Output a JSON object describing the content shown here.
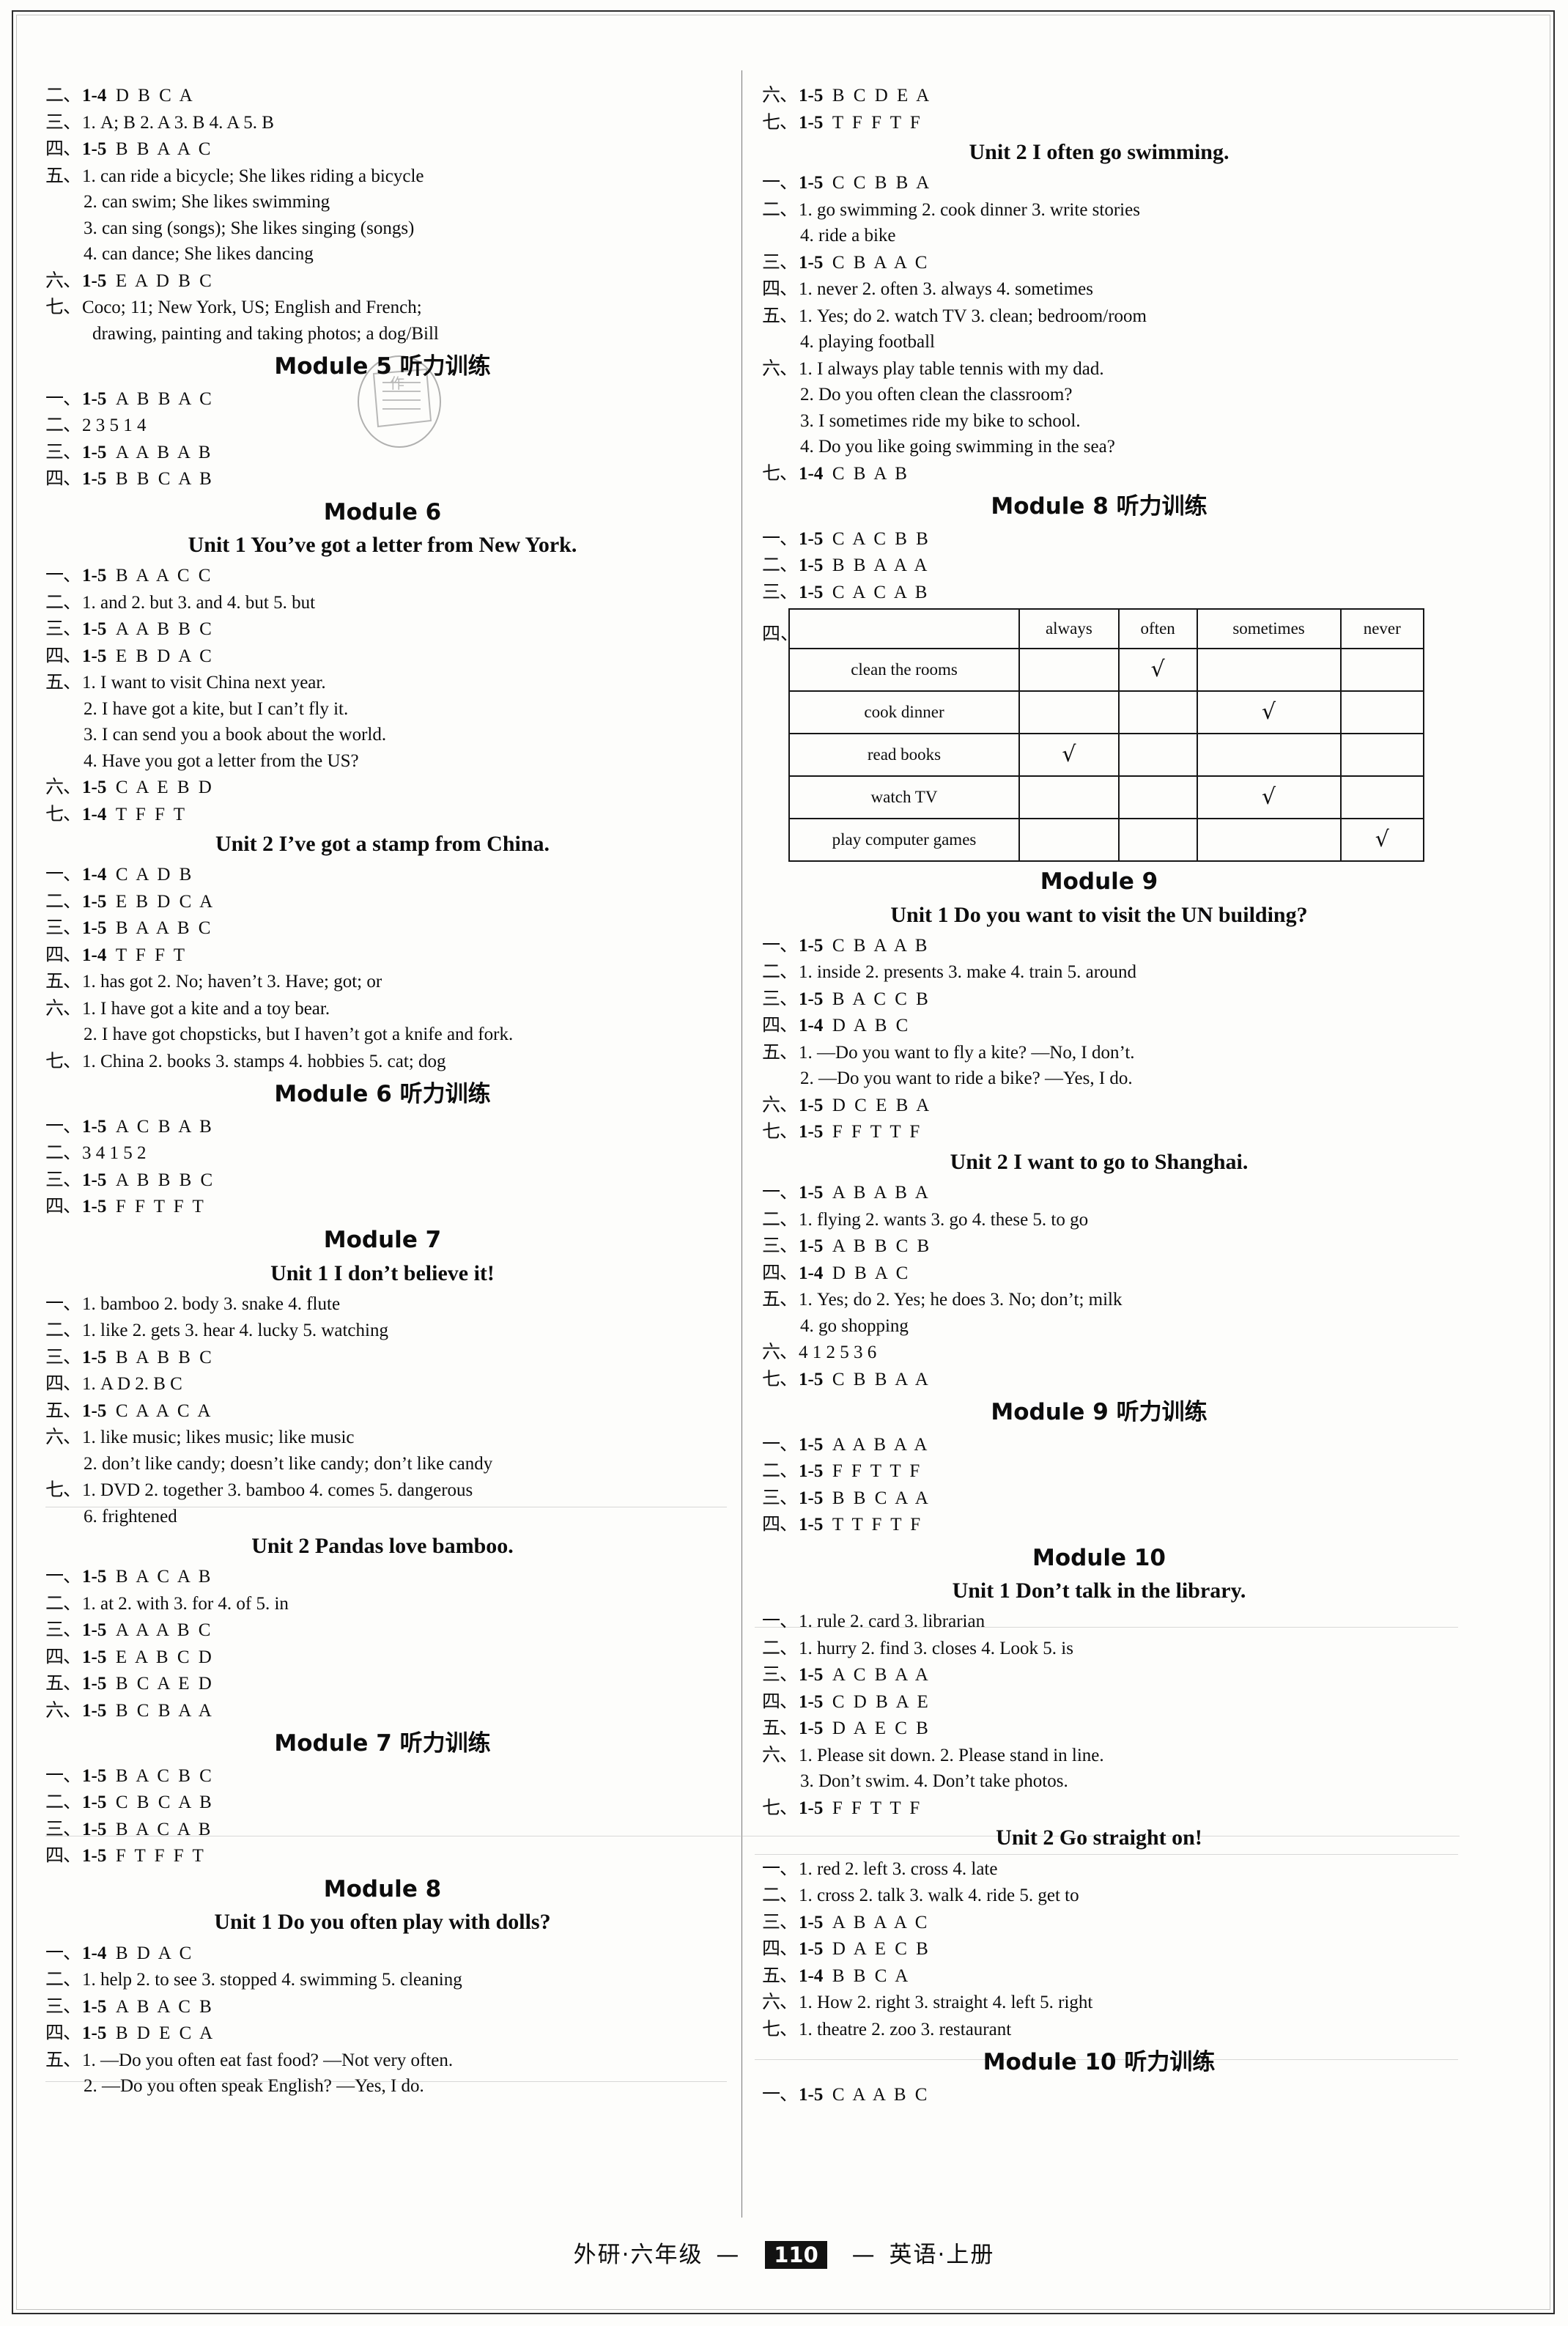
{
  "footer": {
    "left_text": "外研·六年级",
    "dash_left": "—",
    "page_number": "110",
    "dash_right": "—",
    "right_text": "英语·上册"
  },
  "left_column": [
    {
      "kind": "answer",
      "marker": "二、",
      "range": "1-4",
      "answers": "D B C A"
    },
    {
      "kind": "inline",
      "marker": "三、",
      "text": "1. A; B   2. A   3. B   4. A   5. B"
    },
    {
      "kind": "answer",
      "marker": "四、",
      "range": "1-5",
      "answers": "B B A A C"
    },
    {
      "kind": "inline",
      "marker": "五、",
      "text": "1. can ride a bicycle; She likes riding a bicycle"
    },
    {
      "kind": "sub",
      "text": "2. can swim; She likes swimming"
    },
    {
      "kind": "sub",
      "text": "3. can sing (songs); She likes singing (songs)"
    },
    {
      "kind": "sub",
      "text": "4. can dance; She likes dancing"
    },
    {
      "kind": "answer",
      "marker": "六、",
      "range": "1-5",
      "answers": "E A D B C"
    },
    {
      "kind": "inline",
      "marker": "七、",
      "text": "Coco; 11; New York, US; English and French;"
    },
    {
      "kind": "cont",
      "text": "drawing, painting and taking photos; a dog/Bill"
    },
    {
      "kind": "module",
      "text": "Module 5   听力训练"
    },
    {
      "kind": "answer",
      "marker": "一、",
      "range": "1-5",
      "answers": "A B B A C"
    },
    {
      "kind": "inline",
      "marker": "二、",
      "text": "2 3 5 1 4"
    },
    {
      "kind": "answer",
      "marker": "三、",
      "range": "1-5",
      "answers": "A A B A B"
    },
    {
      "kind": "answer",
      "marker": "四、",
      "range": "1-5",
      "answers": "B B C A B"
    },
    {
      "kind": "module",
      "text": "Module 6"
    },
    {
      "kind": "unit",
      "text": "Unit 1   You’ve got a letter from New York."
    },
    {
      "kind": "answer",
      "marker": "一、",
      "range": "1-5",
      "answers": "B A A C C"
    },
    {
      "kind": "inline",
      "marker": "二、",
      "text": "1. and   2. but   3. and   4. but   5. but"
    },
    {
      "kind": "answer",
      "marker": "三、",
      "range": "1-5",
      "answers": "A A B B C"
    },
    {
      "kind": "answer",
      "marker": "四、",
      "range": "1-5",
      "answers": "E B D A C"
    },
    {
      "kind": "inline",
      "marker": "五、",
      "text": "1. I want to visit China next year."
    },
    {
      "kind": "sub",
      "text": "2. I have got a kite, but I can’t fly it."
    },
    {
      "kind": "sub",
      "text": "3. I can send you a book about the world."
    },
    {
      "kind": "sub",
      "text": "4. Have you got a letter from the US?"
    },
    {
      "kind": "answer",
      "marker": "六、",
      "range": "1-5",
      "answers": "C A E B D"
    },
    {
      "kind": "answer",
      "marker": "七、",
      "range": "1-4",
      "answers": "T F F T"
    },
    {
      "kind": "unit",
      "text": "Unit 2   I’ve got a stamp from China."
    },
    {
      "kind": "answer",
      "marker": "一、",
      "range": "1-4",
      "answers": "C A D B"
    },
    {
      "kind": "answer",
      "marker": "二、",
      "range": "1-5",
      "answers": "E B D C A"
    },
    {
      "kind": "answer",
      "marker": "三、",
      "range": "1-5",
      "answers": "B A A B C"
    },
    {
      "kind": "answer",
      "marker": "四、",
      "range": "1-4",
      "answers": "T F F T"
    },
    {
      "kind": "inline",
      "marker": "五、",
      "text": "1. has got   2. No; haven’t   3. Have; got; or"
    },
    {
      "kind": "inline",
      "marker": "六、",
      "text": "1. I have got a kite and a toy bear."
    },
    {
      "kind": "sub",
      "text": "2. I have got chopsticks, but I haven’t got a knife and fork."
    },
    {
      "kind": "inline",
      "marker": "七、",
      "text": "1. China   2. books   3. stamps   4. hobbies   5. cat; dog"
    },
    {
      "kind": "module",
      "text": "Module 6   听力训练"
    },
    {
      "kind": "answer",
      "marker": "一、",
      "range": "1-5",
      "answers": "A C B A B"
    },
    {
      "kind": "inline",
      "marker": "二、",
      "text": "3 4 1 5 2"
    },
    {
      "kind": "answer",
      "marker": "三、",
      "range": "1-5",
      "answers": "A B B B C"
    },
    {
      "kind": "answer",
      "marker": "四、",
      "range": "1-5",
      "answers": "F F T F T"
    },
    {
      "kind": "module",
      "text": "Module 7"
    },
    {
      "kind": "unit",
      "text": "Unit 1   I don’t believe it!"
    },
    {
      "kind": "inline",
      "marker": "一、",
      "text": "1. bamboo   2. body   3. snake   4. flute"
    },
    {
      "kind": "inline",
      "marker": "二、",
      "text": "1. like   2. gets   3. hear   4. lucky   5. watching"
    },
    {
      "kind": "answer",
      "marker": "三、",
      "range": "1-5",
      "answers": "B A B B C"
    },
    {
      "kind": "inline",
      "marker": "四、",
      "text": "1. A D   2. B C"
    },
    {
      "kind": "answer",
      "marker": "五、",
      "range": "1-5",
      "answers": "C A A C A"
    },
    {
      "kind": "inline",
      "marker": "六、",
      "text": "1. like music; likes music; like music"
    },
    {
      "kind": "sub",
      "text": "2. don’t like candy; doesn’t like candy; don’t like candy"
    },
    {
      "kind": "inline",
      "marker": "七、",
      "text": "1. DVD   2. together   3. bamboo   4. comes   5. dangerous"
    },
    {
      "kind": "sub",
      "text": "6. frightened"
    },
    {
      "kind": "unit",
      "text": "Unit 2   Pandas love bamboo."
    },
    {
      "kind": "answer",
      "marker": "一、",
      "range": "1-5",
      "answers": "B A C A B"
    },
    {
      "kind": "inline",
      "marker": "二、",
      "text": "1. at   2. with   3. for   4. of   5. in"
    },
    {
      "kind": "answer",
      "marker": "三、",
      "range": "1-5",
      "answers": "A A A B C"
    },
    {
      "kind": "answer",
      "marker": "四、",
      "range": "1-5",
      "answers": "E A B C D"
    },
    {
      "kind": "answer",
      "marker": "五、",
      "range": "1-5",
      "answers": "B C A E D"
    },
    {
      "kind": "answer",
      "marker": "六、",
      "range": "1-5",
      "answers": "B C B A A"
    },
    {
      "kind": "module",
      "text": "Module 7   听力训练"
    },
    {
      "kind": "answer",
      "marker": "一、",
      "range": "1-5",
      "answers": "B A C B C"
    },
    {
      "kind": "answer",
      "marker": "二、",
      "range": "1-5",
      "answers": "C B C A B"
    },
    {
      "kind": "answer",
      "marker": "三、",
      "range": "1-5",
      "answers": "B A C A B"
    },
    {
      "kind": "answer",
      "marker": "四、",
      "range": "1-5",
      "answers": "F T F F T"
    },
    {
      "kind": "module",
      "text": "Module 8"
    },
    {
      "kind": "unit",
      "text": "Unit 1   Do you often play with dolls?"
    },
    {
      "kind": "answer",
      "marker": "一、",
      "range": "1-4",
      "answers": "B D A C"
    },
    {
      "kind": "inline",
      "marker": "二、",
      "text": "1. help   2. to see   3. stopped   4. swimming   5. cleaning"
    },
    {
      "kind": "answer",
      "marker": "三、",
      "range": "1-5",
      "answers": "A B A C B"
    },
    {
      "kind": "answer",
      "marker": "四、",
      "range": "1-5",
      "answers": "B D E C A"
    },
    {
      "kind": "inline",
      "marker": "五、",
      "text": "1. —Do you often eat fast food?     —Not very often."
    },
    {
      "kind": "sub",
      "text": "2. —Do you often speak English?     —Yes, I do."
    }
  ],
  "right_column": [
    {
      "kind": "answer",
      "marker": "六、",
      "range": "1-5",
      "answers": "B C D E A"
    },
    {
      "kind": "answer",
      "marker": "七、",
      "range": "1-5",
      "answers": "T F F T F"
    },
    {
      "kind": "unit",
      "text": "Unit 2   I often go swimming."
    },
    {
      "kind": "answer",
      "marker": "一、",
      "range": "1-5",
      "answers": "C C B B A"
    },
    {
      "kind": "inline",
      "marker": "二、",
      "text": "1. go swimming   2. cook dinner   3. write stories"
    },
    {
      "kind": "sub",
      "text": "4. ride a bike"
    },
    {
      "kind": "answer",
      "marker": "三、",
      "range": "1-5",
      "answers": "C B A A C"
    },
    {
      "kind": "inline",
      "marker": "四、",
      "text": "1. never   2. often   3. always   4. sometimes"
    },
    {
      "kind": "inline",
      "marker": "五、",
      "text": "1. Yes; do   2. watch TV   3. clean; bedroom/room"
    },
    {
      "kind": "sub",
      "text": "4. playing football"
    },
    {
      "kind": "inline",
      "marker": "六、",
      "text": "1. I always play table tennis with my dad."
    },
    {
      "kind": "sub",
      "text": "2. Do you often clean the classroom?"
    },
    {
      "kind": "sub",
      "text": "3. I sometimes ride my bike to school."
    },
    {
      "kind": "sub",
      "text": "4. Do you like going swimming in the sea?"
    },
    {
      "kind": "answer",
      "marker": "七、",
      "range": "1-4",
      "answers": "C B A B"
    },
    {
      "kind": "module",
      "text": "Module 8   听力训练"
    },
    {
      "kind": "answer",
      "marker": "一、",
      "range": "1-5",
      "answers": "C A C B B"
    },
    {
      "kind": "answer",
      "marker": "二、",
      "range": "1-5",
      "answers": "B B A A A"
    },
    {
      "kind": "answer",
      "marker": "三、",
      "range": "1-5",
      "answers": "C A C A B"
    },
    {
      "kind": "table",
      "marker": "四、"
    },
    {
      "kind": "module",
      "text": "Module 9"
    },
    {
      "kind": "unit",
      "text": "Unit 1   Do you want to visit the UN building?"
    },
    {
      "kind": "answer",
      "marker": "一、",
      "range": "1-5",
      "answers": "C B A A B"
    },
    {
      "kind": "inline",
      "marker": "二、",
      "text": "1. inside   2. presents   3. make   4. train   5. around"
    },
    {
      "kind": "answer",
      "marker": "三、",
      "range": "1-5",
      "answers": "B A C C B"
    },
    {
      "kind": "answer",
      "marker": "四、",
      "range": "1-4",
      "answers": "D A B C"
    },
    {
      "kind": "inline",
      "marker": "五、",
      "text": "1. —Do you want to fly a kite?     —No, I don’t."
    },
    {
      "kind": "sub",
      "text": "2. —Do you want to ride a bike?     —Yes, I do."
    },
    {
      "kind": "answer",
      "marker": "六、",
      "range": "1-5",
      "answers": "D C E B A"
    },
    {
      "kind": "answer",
      "marker": "七、",
      "range": "1-5",
      "answers": "F F T T F"
    },
    {
      "kind": "unit",
      "text": "Unit 2   I want to go to Shanghai."
    },
    {
      "kind": "answer",
      "marker": "一、",
      "range": "1-5",
      "answers": "A B A B A"
    },
    {
      "kind": "inline",
      "marker": "二、",
      "text": "1. flying   2. wants   3. go   4. these   5. to go"
    },
    {
      "kind": "answer",
      "marker": "三、",
      "range": "1-5",
      "answers": "A B B C B"
    },
    {
      "kind": "answer",
      "marker": "四、",
      "range": "1-4",
      "answers": "D B A C"
    },
    {
      "kind": "inline",
      "marker": "五、",
      "text": "1. Yes; do   2. Yes; he does   3. No; don’t; milk"
    },
    {
      "kind": "sub",
      "text": "4. go shopping"
    },
    {
      "kind": "inline",
      "marker": "六、",
      "text": "4 1 2 5 3 6"
    },
    {
      "kind": "answer",
      "marker": "七、",
      "range": "1-5",
      "answers": "C B B A A"
    },
    {
      "kind": "module",
      "text": "Module 9   听力训练"
    },
    {
      "kind": "answer",
      "marker": "一、",
      "range": "1-5",
      "answers": "A A B A A"
    },
    {
      "kind": "answer",
      "marker": "二、",
      "range": "1-5",
      "answers": "F F T T F"
    },
    {
      "kind": "answer",
      "marker": "三、",
      "range": "1-5",
      "answers": "B B C A A"
    },
    {
      "kind": "answer",
      "marker": "四、",
      "range": "1-5",
      "answers": "T T F T F"
    },
    {
      "kind": "module",
      "text": "Module 10"
    },
    {
      "kind": "unit",
      "text": "Unit 1   Don’t talk in the library."
    },
    {
      "kind": "inline",
      "marker": "一、",
      "text": "1. rule   2. card   3. librarian"
    },
    {
      "kind": "inline",
      "marker": "二、",
      "text": "1. hurry   2. find   3. closes   4. Look   5. is"
    },
    {
      "kind": "answer",
      "marker": "三、",
      "range": "1-5",
      "answers": "A C B A A"
    },
    {
      "kind": "answer",
      "marker": "四、",
      "range": "1-5",
      "answers": "C D B A E"
    },
    {
      "kind": "answer",
      "marker": "五、",
      "range": "1-5",
      "answers": "D A E C B"
    },
    {
      "kind": "inline",
      "marker": "六、",
      "text": "1. Please sit down.     2. Please stand in line."
    },
    {
      "kind": "sub",
      "text": "3. Don’t swim.   4. Don’t take photos."
    },
    {
      "kind": "answer",
      "marker": "七、",
      "range": "1-5",
      "answers": "F F T T F"
    },
    {
      "kind": "unit",
      "text": "Unit 2   Go straight on!"
    },
    {
      "kind": "inline",
      "marker": "一、",
      "text": "1. red   2. left   3. cross   4. late"
    },
    {
      "kind": "inline",
      "marker": "二、",
      "text": "1. cross   2. talk   3. walk   4. ride   5. get to"
    },
    {
      "kind": "answer",
      "marker": "三、",
      "range": "1-5",
      "answers": "A B A A C"
    },
    {
      "kind": "answer",
      "marker": "四、",
      "range": "1-5",
      "answers": "D A E C B"
    },
    {
      "kind": "answer",
      "marker": "五、",
      "range": "1-4",
      "answers": "B B C A"
    },
    {
      "kind": "inline",
      "marker": "六、",
      "text": "1. How   2. right   3. straight   4. left   5. right"
    },
    {
      "kind": "inline",
      "marker": "七、",
      "text": "1. theatre   2. zoo   3. restaurant"
    },
    {
      "kind": "module",
      "text": "Module 10   听力训练"
    },
    {
      "kind": "answer",
      "marker": "一、",
      "range": "1-5",
      "answers": "C A A B C"
    }
  ],
  "frequency_table": {
    "marker": "四、",
    "columns": [
      "",
      "always",
      "often",
      "sometimes",
      "never"
    ],
    "check_glyph": "√",
    "rows": [
      {
        "label": "clean the rooms",
        "checked": "often"
      },
      {
        "label": "cook dinner",
        "checked": "sometimes"
      },
      {
        "label": "read books",
        "checked": "always"
      },
      {
        "label": "watch TV",
        "checked": "sometimes"
      },
      {
        "label": "play computer games",
        "checked": "never"
      }
    ]
  }
}
